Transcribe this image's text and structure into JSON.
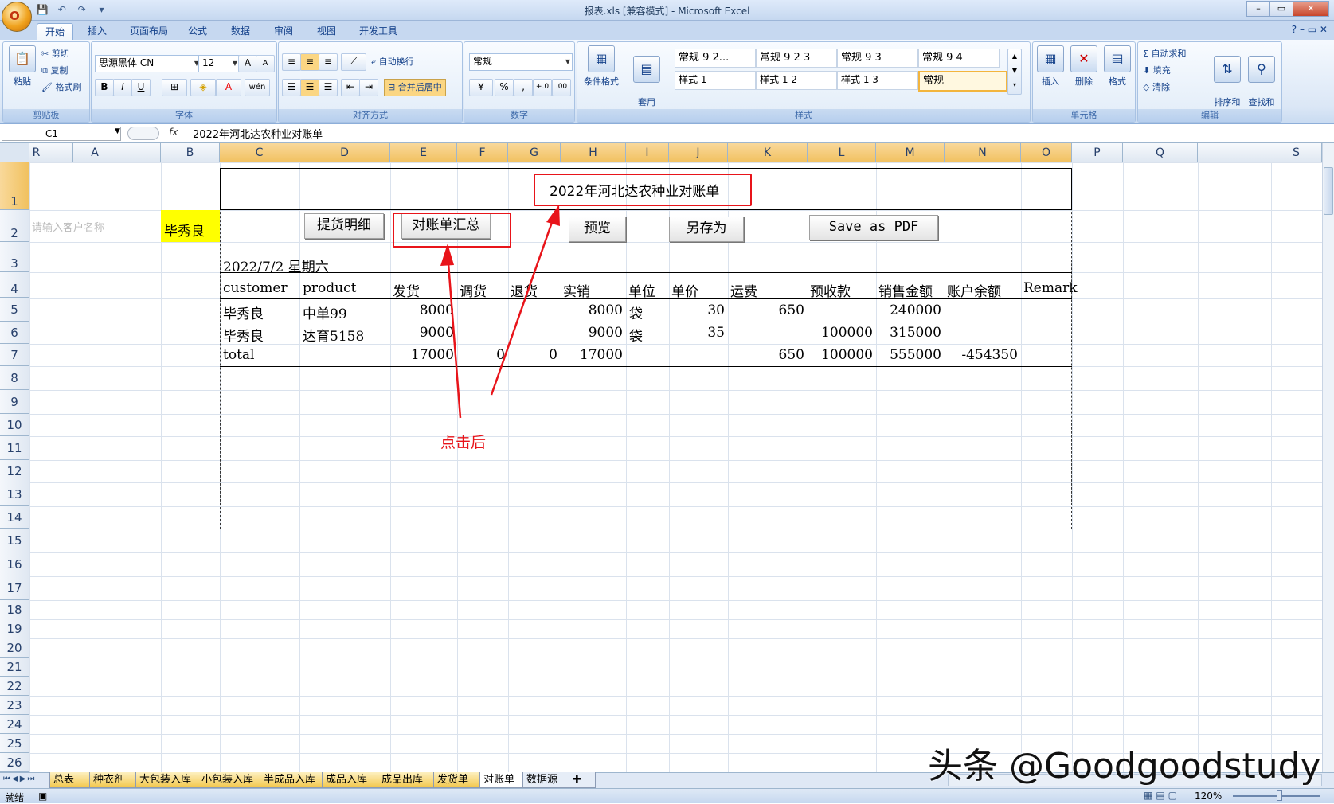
{
  "window": {
    "title": "报表.xls  [兼容模式] - Microsoft Excel",
    "office_button": "O",
    "controls": [
      "–",
      "▭",
      "✕"
    ]
  },
  "qat": [
    "save-icon",
    "undo-icon",
    "redo-icon",
    "customize-icon"
  ],
  "ribbon_tabs": [
    "开始",
    "插入",
    "页面布局",
    "公式",
    "数据",
    "审阅",
    "视图",
    "开发工具"
  ],
  "help_controls": "? – ▭ ✕",
  "ribbon": {
    "clipboard": {
      "label": "剪贴板",
      "paste": "粘贴",
      "cut": "剪切",
      "copy": "复制",
      "format_painter": "格式刷"
    },
    "font": {
      "label": "字体",
      "font_name": "思源黑体 CN",
      "font_size": "12",
      "grow": "A",
      "shrink": "A",
      "bold": "B",
      "italic": "I",
      "underline": "U",
      "border": "⊞",
      "fill": "◈",
      "color": "A",
      "phonetic": "wén"
    },
    "alignment": {
      "label": "对齐方式",
      "wrap": "自动换行",
      "merge": "合并后居中"
    },
    "number": {
      "label": "数字",
      "format": "常规",
      "currency": "¥",
      "percent": "%",
      "comma": ",",
      "inc": "+.0",
      "dec": ".00"
    },
    "styles": {
      "label": "样式",
      "conditional": "条件格式",
      "table": "套用\n表格格式",
      "cells": [
        "常规 9 2...",
        "常规 9 2 3",
        "常规 9 3",
        "常规 9 4",
        "样式 1",
        "样式 1 2",
        "样式 1 3",
        "常规"
      ]
    },
    "cells": {
      "label": "单元格",
      "insert": "插入",
      "delete": "删除",
      "format": "格式"
    },
    "editing": {
      "label": "编辑",
      "autosum": "自动求和",
      "fill": "填充",
      "clear": "清除",
      "sort": "排序和\n筛选",
      "find": "查找和\n选择"
    }
  },
  "formula_bar": {
    "name_box": "C1",
    "fx": "fx",
    "formula": "2022年河北达农种业对账单"
  },
  "columns": [
    "A",
    "B",
    "C",
    "D",
    "E",
    "F",
    "G",
    "H",
    "I",
    "J",
    "K",
    "L",
    "M",
    "N",
    "O",
    "P",
    "Q",
    "R",
    "S"
  ],
  "rows": [
    "1",
    "2",
    "3",
    "4",
    "5",
    "6",
    "7",
    "8",
    "9",
    "10",
    "11",
    "12",
    "13",
    "14",
    "15",
    "16",
    "17",
    "18",
    "19",
    "20",
    "21",
    "22",
    "23",
    "24",
    "25",
    "26"
  ],
  "sheet": {
    "title": "2022年河北达农种业对账单",
    "customer_placeholder": "请输入客户名称",
    "customer": "毕秀良",
    "buttons": {
      "detail": "提货明细",
      "summary": "对账单汇总",
      "preview": "预览",
      "save_as": "另存为",
      "pdf": "Save as PDF"
    },
    "date_line": "2022/7/2  星期六",
    "headers": [
      "customer",
      "product",
      "发货",
      "调货",
      "退货",
      "实销",
      "单位",
      "单价",
      "运费",
      "预收款",
      "销售金额",
      "账户余额",
      "Remark"
    ],
    "data_rows": [
      [
        "毕秀良",
        "中单99",
        "8000",
        "",
        "",
        "8000",
        "袋",
        "30",
        "650",
        "",
        "240000",
        "",
        ""
      ],
      [
        "毕秀良",
        "达育5158",
        "9000",
        "",
        "",
        "9000",
        "袋",
        "35",
        "",
        "100000",
        "315000",
        "",
        ""
      ]
    ],
    "total_row": [
      "total",
      "",
      "17000",
      "0",
      "0",
      "17000",
      "",
      "",
      "650",
      "100000",
      "555000",
      "-454350",
      ""
    ],
    "annotation": "点击后"
  },
  "sheet_tabs": [
    "总表",
    "种衣剂",
    "大包装入库",
    "小包装入库",
    "半成品入库",
    "成品入库",
    "成品出库",
    "发货单",
    "对账单",
    "数据源"
  ],
  "active_sheet": "对账单",
  "status": {
    "ready": "就绪",
    "zoom": "120%"
  },
  "watermark": "头条 @Goodgoodstudy",
  "colors": {
    "accent_red": "#e8141a",
    "yellow_highlight": "#ffff00",
    "ribbon_blue": "#c6d8f0"
  }
}
